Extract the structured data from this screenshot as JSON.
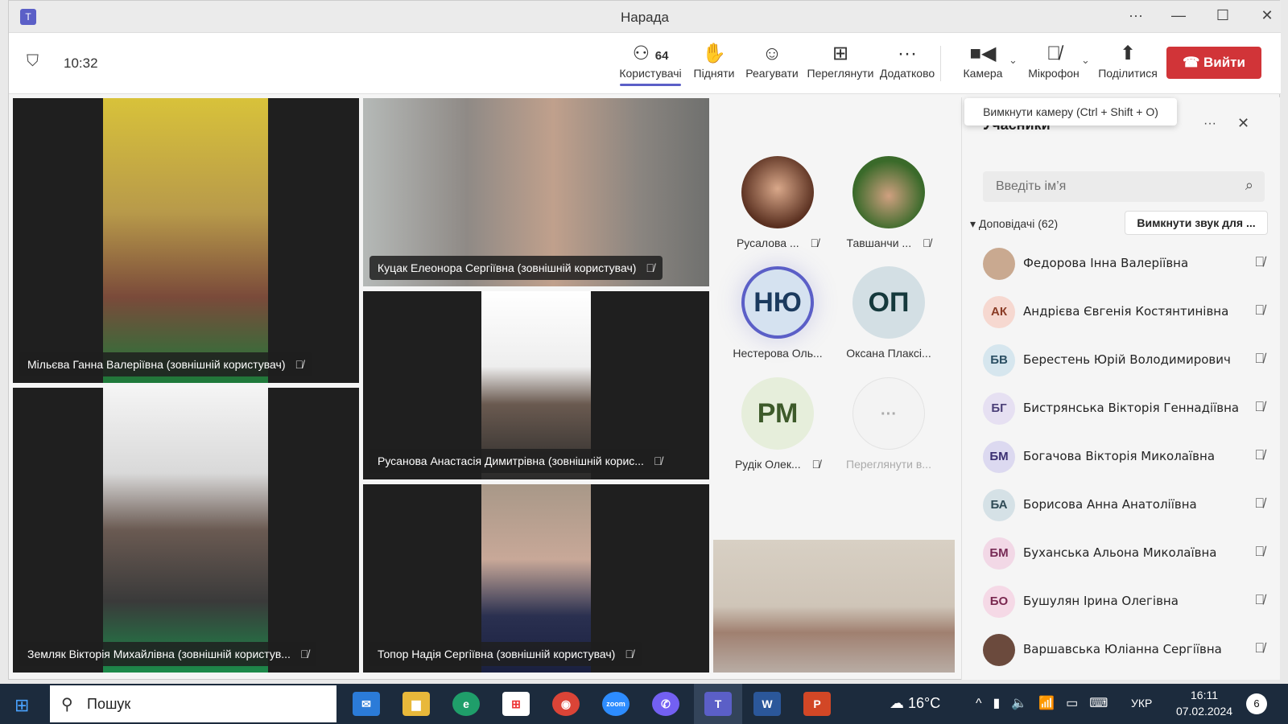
{
  "window": {
    "title": "Нарада",
    "more": "···",
    "minimize": "—",
    "maximize": "☐",
    "close": "✕"
  },
  "toolbar": {
    "time": "10:32",
    "participants_count": "64",
    "items": [
      {
        "label": "Користувачі",
        "icon": "people-icon"
      },
      {
        "label": "Підняти",
        "icon": "hand-icon"
      },
      {
        "label": "Реагувати",
        "icon": "smile-icon"
      },
      {
        "label": "Переглянути",
        "icon": "grid-icon"
      },
      {
        "label": "Додатково",
        "icon": "more-icon"
      },
      {
        "label": "Камера",
        "icon": "camera-icon"
      },
      {
        "label": "Мікрофон",
        "icon": "mic-off-icon"
      },
      {
        "label": "Поділитися",
        "icon": "share-icon"
      }
    ],
    "leave": "Вийти",
    "accent": "#5b5fc7",
    "leave_color": "#d13438"
  },
  "tooltip": "Вимкнути камеру (Ctrl + Shift + O)",
  "videos": [
    {
      "name": "Мільєва Ганна Валеріївна (зовнішній користувач)"
    },
    {
      "name": "Земляк Вікторія Михайлівна (зовнішній користув..."
    },
    {
      "name": "Куцак Елеонора Сергіївна (зовнішній користувач)"
    },
    {
      "name": "Русанова Анастасія Димитрівна (зовнішній корис..."
    },
    {
      "name": "Топор Надія Сергіївна (зовнішній користувач)"
    }
  ],
  "gallery": [
    {
      "name": "Русалова ...",
      "initials": "",
      "muted": true
    },
    {
      "name": "Тавшанчи ...",
      "initials": "",
      "muted": true
    },
    {
      "name": "Нестерова Оль...",
      "initials": "НЮ",
      "muted": false
    },
    {
      "name": "Оксана Плаксі...",
      "initials": "ОП",
      "muted": false
    },
    {
      "name": "Рудік Олек...",
      "initials": "РМ",
      "muted": true
    },
    {
      "name": "Переглянути в...",
      "initials": "···",
      "muted": false
    }
  ],
  "panel": {
    "title": "Учасники",
    "search_placeholder": "Введіть ім’я",
    "section": "Доповідачі (62)",
    "mute_all": "Вимкнути звук для ...",
    "people": [
      {
        "name": "Федорова Інна Валеріївна",
        "initials": "",
        "bg": "#c9a990",
        "fg": "#fff"
      },
      {
        "name": "Андрієва Євгенія Костянтинівна",
        "initials": "АК",
        "bg": "#f6d8d0",
        "fg": "#8a3b25"
      },
      {
        "name": "Берестень Юрій Володимирович",
        "initials": "БВ",
        "bg": "#d6e6ee",
        "fg": "#2b4f63"
      },
      {
        "name": "Бистрянська Вікторія Геннадіївна",
        "initials": "БГ",
        "bg": "#e6e0f2",
        "fg": "#4b3f78"
      },
      {
        "name": "Богачова Вікторія Миколаївна",
        "initials": "БМ",
        "bg": "#dcd9f0",
        "fg": "#3b2f72"
      },
      {
        "name": "Борисова Анна Анатоліївна",
        "initials": "БА",
        "bg": "#d5e1e6",
        "fg": "#2f4a55"
      },
      {
        "name": "Буханська Альона Миколаївна",
        "initials": "БМ",
        "bg": "#f2d8e6",
        "fg": "#772a55"
      },
      {
        "name": "Бушулян Ірина Олегівна",
        "initials": "БО",
        "bg": "#f5d9e6",
        "fg": "#7a2950"
      },
      {
        "name": "Варшавська Юліанна Сергіївна",
        "initials": "",
        "bg": "#6b4a3d",
        "fg": "#fff"
      }
    ]
  },
  "taskbar": {
    "search": "Пошук",
    "weather": "16°C",
    "lang": "УКР",
    "time": "16:11",
    "date": "07.02.2024",
    "notifications": "6"
  }
}
